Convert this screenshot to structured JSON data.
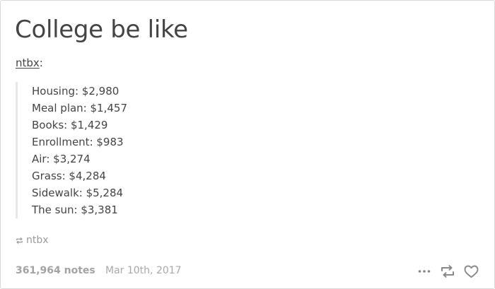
{
  "post": {
    "title": "College be like",
    "source_user": "ntbx",
    "source_colon": ":",
    "quote_lines": [
      "Housing: $2,980",
      "Meal plan: $1,457",
      "Books: $1,429",
      "Enrollment: $983",
      "Air: $3,274",
      "Grass: $4,284",
      "Sidewalk: $5,284",
      "The sun: $3,381"
    ],
    "reblogged_from": "ntbx"
  },
  "footer": {
    "notes": "361,964 notes",
    "date": "Mar 10th, 2017"
  },
  "icons": {
    "more": "more-icon",
    "reblog": "reblog-icon",
    "like": "heart-icon",
    "reblog_small": "reblog-small-icon"
  },
  "colors": {
    "text": "#444444",
    "muted": "#a3a3a3",
    "quote_border": "#e7e7e7",
    "icon": "#888888"
  }
}
